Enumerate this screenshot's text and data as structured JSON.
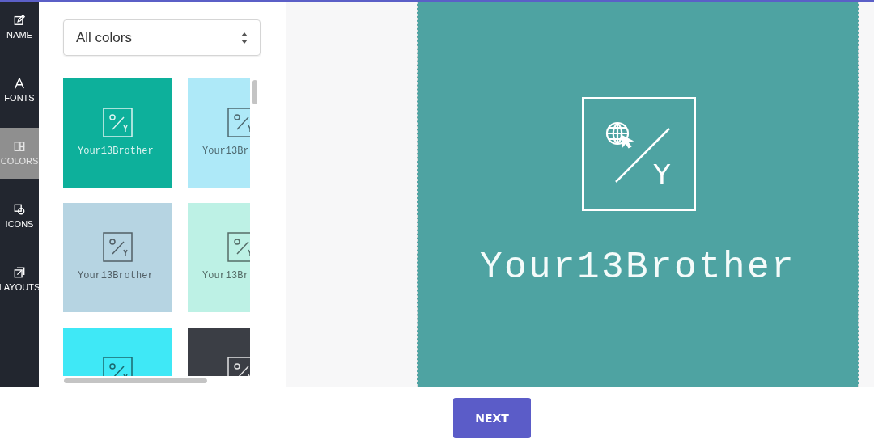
{
  "sidebar": {
    "items": [
      {
        "label": "NAME",
        "kind": "edit",
        "selected": false
      },
      {
        "label": "FONTS",
        "kind": "font",
        "selected": false
      },
      {
        "label": "COLORS",
        "kind": "palette",
        "selected": true
      },
      {
        "label": "ICONS",
        "kind": "shapes",
        "selected": false
      },
      {
        "label": "LAYOUTS",
        "kind": "layers",
        "selected": false
      }
    ]
  },
  "color_filter": {
    "value": "All colors"
  },
  "swatches": [
    {
      "color": "#0db09b",
      "name": "Your13Brother"
    },
    {
      "color": "#aee9f8",
      "name": "Your13Br"
    },
    {
      "color": "#b6d4e2",
      "name": "Your13Brother"
    },
    {
      "color": "#bdf1e5",
      "name": "Your13Br"
    },
    {
      "color": "#3fe8f6"
    },
    {
      "color": "#3b3e45"
    }
  ],
  "preview": {
    "monogram": "Y",
    "name": "Your13Brother"
  },
  "buttons": [
    {
      "label": "NEXT"
    }
  ]
}
